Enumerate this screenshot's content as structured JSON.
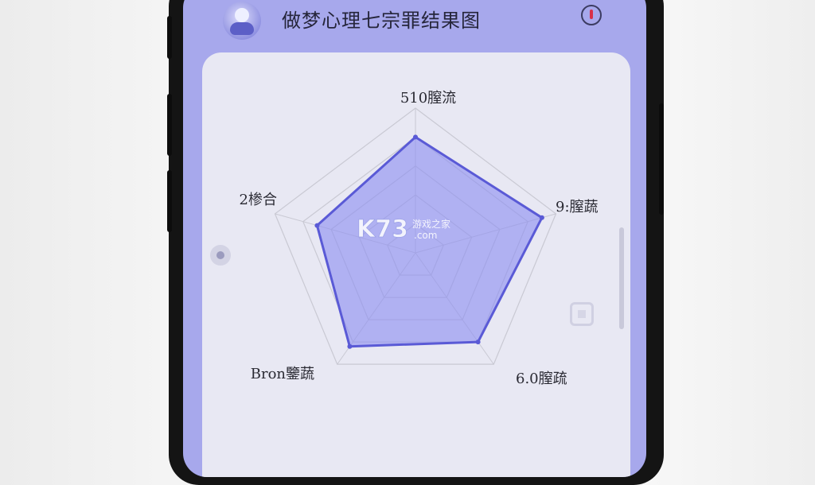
{
  "app": {
    "title": "做梦心理七宗罪结果图",
    "icon": "avatar-icon",
    "header_action_icon": "record-icon"
  },
  "radar": {
    "labels": [
      "510膣流",
      "9:膣蔬",
      "6.0膣疏",
      "Bron鑒蔬",
      "2椮合"
    ],
    "values": [
      0.8,
      0.9,
      0.8,
      0.84,
      0.7
    ],
    "rings": 5,
    "fill_color": "#8e8ff0",
    "stroke_color": "#5a5ad6",
    "grid_color": "#c9c9d3"
  },
  "watermark": {
    "logo": "K73",
    "line1": "游戏之家",
    "line2": ".com"
  }
}
